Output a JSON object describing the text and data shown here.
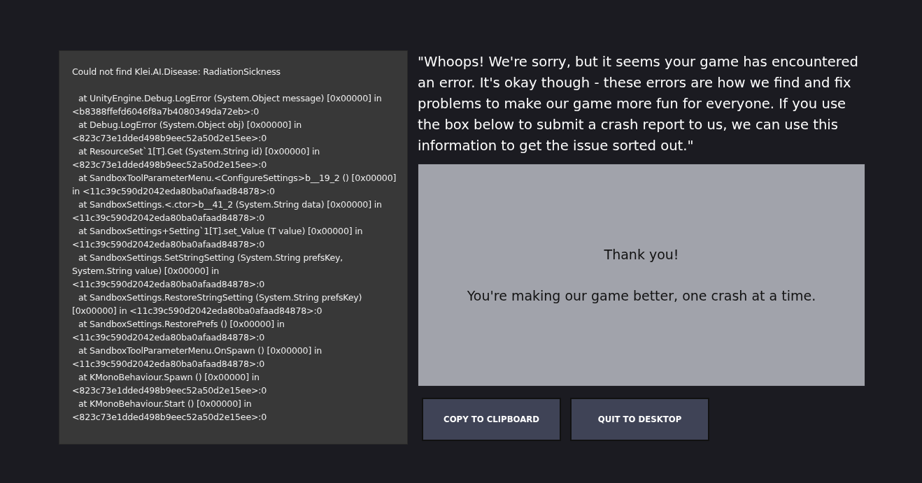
{
  "error_log": {
    "message": "Could not find Klei.AI.Disease: RadiationSickness",
    "frames": [
      "at UnityEngine.Debug.LogError (System.Object message) [0x00000] in <b8388ffefd6046f8a7b4080349da72eb>:0",
      "at Debug.LogError (System.Object obj) [0x00000] in <823c73e1dded498b9eec52a50d2e15ee>:0",
      "at ResourceSet`1[T].Get (System.String id) [0x00000] in <823c73e1dded498b9eec52a50d2e15ee>:0",
      "at SandboxToolParameterMenu.<ConfigureSettings>b__19_2 () [0x00000] in <11c39c590d2042eda80ba0afaad84878>:0",
      "at SandboxSettings.<.ctor>b__41_2 (System.String data) [0x00000] in <11c39c590d2042eda80ba0afaad84878>:0",
      "at SandboxSettings+Setting`1[T].set_Value (T value) [0x00000] in <11c39c590d2042eda80ba0afaad84878>:0",
      "at SandboxSettings.SetStringSetting (System.String prefsKey, System.String value) [0x00000] in <11c39c590d2042eda80ba0afaad84878>:0",
      "at SandboxSettings.RestoreStringSetting (System.String prefsKey) [0x00000] in <11c39c590d2042eda80ba0afaad84878>:0",
      "at SandboxSettings.RestorePrefs () [0x00000] in <11c39c590d2042eda80ba0afaad84878>:0",
      "at SandboxToolParameterMenu.OnSpawn () [0x00000] in <11c39c590d2042eda80ba0afaad84878>:0",
      "at KMonoBehaviour.Spawn () [0x00000] in <823c73e1dded498b9eec52a50d2e15ee>:0",
      "at KMonoBehaviour.Start () [0x00000] in <823c73e1dded498b9eec52a50d2e15ee>:0"
    ]
  },
  "apology": "\"Whoops! We're sorry, but it seems your game has encountered an error. It's okay though - these errors are how we find and fix problems to make our game more fun for everyone. If you use the box below to submit a crash report to us, we can use this information to get the issue sorted out.\"",
  "report_box": {
    "title": "Thank you!",
    "subtitle": "You're making our game better, one crash at a time."
  },
  "buttons": [
    "COPY TO CLIPBOARD",
    "QUIT TO DESKTOP"
  ]
}
